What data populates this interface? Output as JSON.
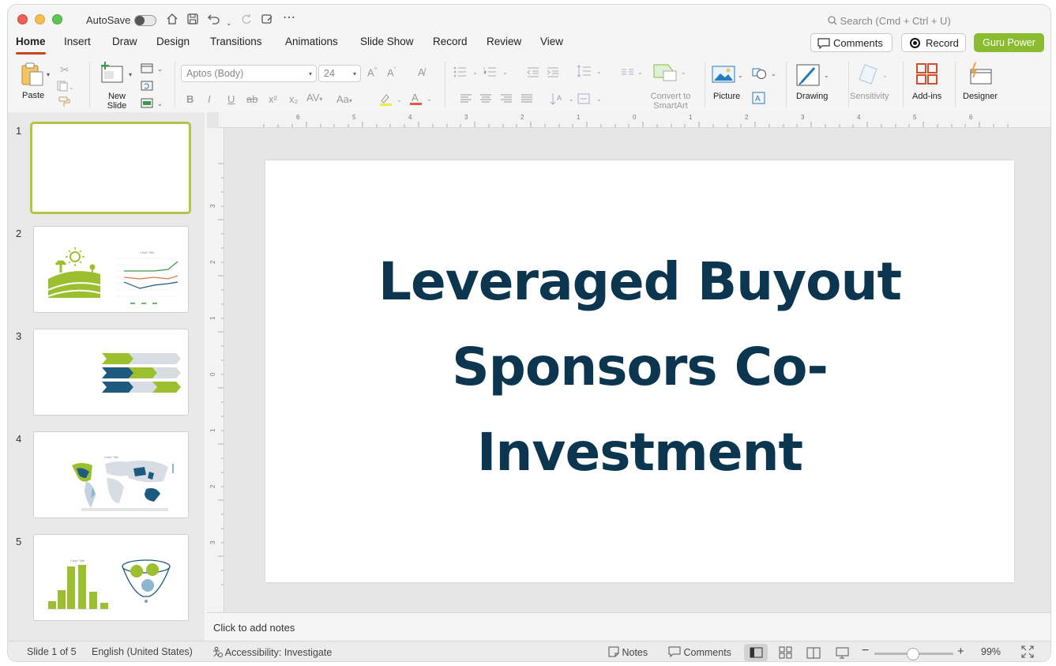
{
  "titlebar": {
    "autosave_label": "AutoSave",
    "search_placeholder": "Search (Cmd + Ctrl + U)"
  },
  "tabs": [
    {
      "label": "Home",
      "active": true
    },
    {
      "label": "Insert"
    },
    {
      "label": "Draw"
    },
    {
      "label": "Design"
    },
    {
      "label": "Transitions"
    },
    {
      "label": "Animations"
    },
    {
      "label": "Slide Show"
    },
    {
      "label": "Record"
    },
    {
      "label": "Review"
    },
    {
      "label": "View"
    }
  ],
  "top_buttons": {
    "comments": "Comments",
    "record": "Record",
    "guru": "Guru Power"
  },
  "ribbon": {
    "paste": "Paste",
    "new_slide": "New Slide",
    "font_name": "Aptos (Body)",
    "font_size": "24",
    "convert_smartart": "Convert to SmartArt",
    "picture": "Picture",
    "drawing": "Drawing",
    "sensitivity": "Sensitivity",
    "addins": "Add-ins",
    "designer": "Designer"
  },
  "slides": [
    {
      "number": "1",
      "selected": true
    },
    {
      "number": "2"
    },
    {
      "number": "3"
    },
    {
      "number": "4"
    },
    {
      "number": "5"
    }
  ],
  "current_slide": {
    "title_lines": [
      "Leveraged Buyout",
      "Sponsors Co-",
      "Investment"
    ],
    "title_color": "#0c3650"
  },
  "notes_placeholder": "Click to add notes",
  "statusbar": {
    "slide_of": "Slide 1 of 5",
    "language": "English (United States)",
    "accessibility": "Accessibility: Investigate",
    "notes": "Notes",
    "comments": "Comments",
    "zoom": "99%"
  },
  "colors": {
    "accent_green": "#8bbb2f",
    "title_navy": "#0c3650",
    "tab_underline": "#c4471f"
  }
}
